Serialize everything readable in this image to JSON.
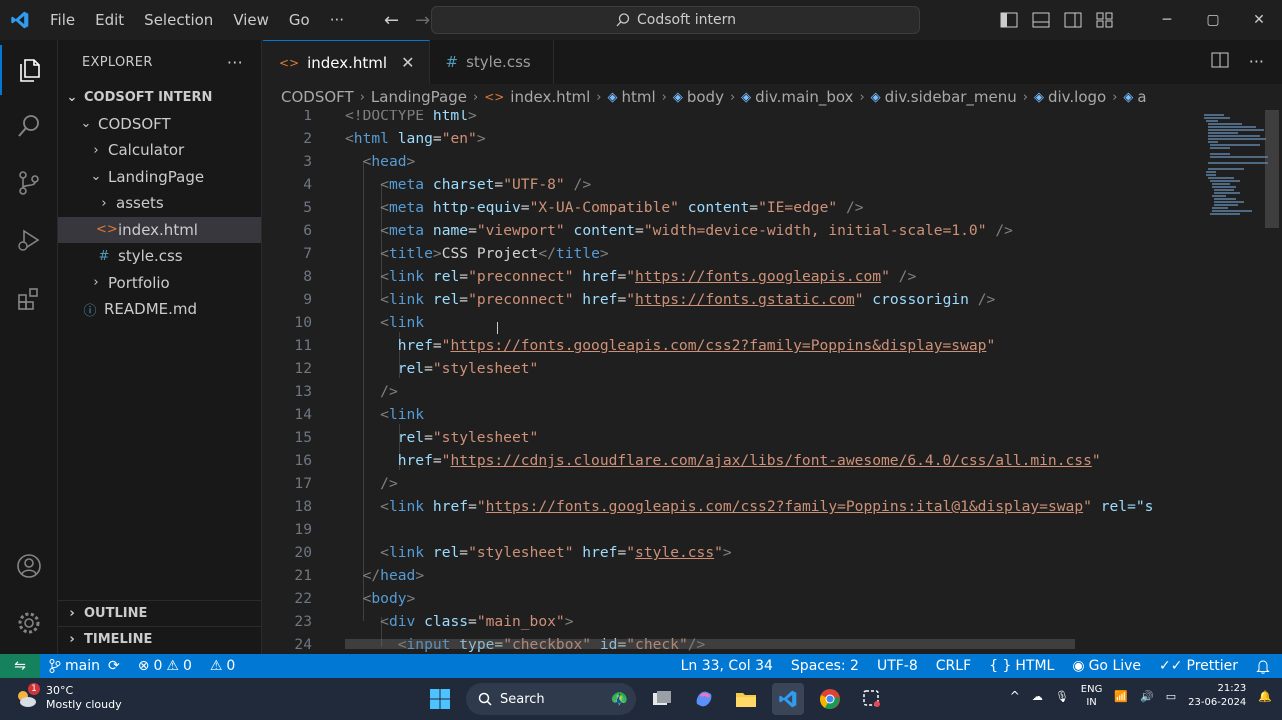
{
  "titlebar": {
    "menu": [
      "File",
      "Edit",
      "Selection",
      "View",
      "Go",
      "···"
    ],
    "command_center": "Codsoft intern",
    "window_controls": [
      "─",
      "▢",
      "✕"
    ]
  },
  "sidebar": {
    "header": "EXPLORER",
    "more": "···",
    "root": "CODSOFT INTERN",
    "items": [
      {
        "label": "CODSOFT",
        "depth": 1,
        "chevron": "⌄"
      },
      {
        "label": "Calculator",
        "depth": 2,
        "chevron": "›"
      },
      {
        "label": "LandingPage",
        "depth": 2,
        "chevron": "⌄"
      },
      {
        "label": "assets",
        "depth": 3,
        "chevron": "›"
      },
      {
        "label": "index.html",
        "depth": 3,
        "icon": "<>"
      },
      {
        "label": "style.css",
        "depth": 3,
        "icon": "#"
      },
      {
        "label": "Portfolio",
        "depth": 2,
        "chevron": "›"
      },
      {
        "label": "README.md",
        "depth": 2,
        "icon": "ⓘ"
      }
    ],
    "outline": "OUTLINE",
    "timeline": "TIMELINE"
  },
  "tabs": [
    {
      "label": "index.html",
      "active": true,
      "icon": "<>",
      "close": "✕"
    },
    {
      "label": "style.css",
      "active": false,
      "icon": "#"
    }
  ],
  "breadcrumb": [
    "CODSOFT",
    "LandingPage",
    "index.html",
    "html",
    "body",
    "div.main_box",
    "div.sidebar_menu",
    "div.logo",
    "a"
  ],
  "code_lines": [
    {
      "n": "1"
    },
    {
      "n": "2"
    },
    {
      "n": "3"
    },
    {
      "n": "4"
    },
    {
      "n": "5"
    },
    {
      "n": "6"
    },
    {
      "n": "7"
    },
    {
      "n": "8"
    },
    {
      "n": "9"
    },
    {
      "n": "10"
    },
    {
      "n": "11"
    },
    {
      "n": "12"
    },
    {
      "n": "13"
    },
    {
      "n": "14"
    },
    {
      "n": "15"
    },
    {
      "n": "16"
    },
    {
      "n": "17"
    },
    {
      "n": "18"
    },
    {
      "n": "19"
    },
    {
      "n": "20"
    },
    {
      "n": "21"
    },
    {
      "n": "22"
    },
    {
      "n": "23"
    },
    {
      "n": "24"
    }
  ],
  "code": {
    "l1_doctype": "<!DOCTYPE",
    "l1_html": " html",
    "l2_lang": "\"en\"",
    "l4_charset": "\"UTF-8\"",
    "l5_equiv": "\"X-UA-Compatible\"",
    "l5_content": "\"IE=edge\"",
    "l6_name": "\"viewport\"",
    "l6_content": "\"width=device-width, initial-scale=1.0\"",
    "l7_title": "CSS Project",
    "l8_rel": "\"preconnect\"",
    "l8_href": "https://fonts.googleapis.com",
    "l9_rel": "\"preconnect\"",
    "l9_href": "https://fonts.gstatic.com",
    "l9_cross": "crossorigin",
    "l11_href": "https://fonts.googleapis.com/css2?family=Poppins&display=swap",
    "l12_rel": "\"stylesheet\"",
    "l15_rel": "\"stylesheet\"",
    "l16_href": "https://cdnjs.cloudflare.com/ajax/libs/font-awesome/6.4.0/css/all.min.css",
    "l18_href": "https://fonts.googleapis.com/css2?family=Poppins:ital@1&display=swap",
    "l18_rel": "rel=\"s",
    "l20_rel": "\"stylesheet\"",
    "l20_href": "style.css",
    "l23_class": "\"main_box\"",
    "l24_type": "\"checkbox\"",
    "l24_id": "\"check\""
  },
  "statusbar": {
    "branch": "main",
    "errors": "0",
    "warnings": "0",
    "ports": "0",
    "position": "Ln 33, Col 34",
    "spaces": "Spaces: 2",
    "encoding": "UTF-8",
    "eol": "CRLF",
    "language": "HTML",
    "golive": "Go Live",
    "prettier": "Prettier"
  },
  "taskbar": {
    "weather_badge": "1",
    "temperature": "30°C",
    "weather": "Mostly cloudy",
    "search": "Search",
    "lang1": "ENG",
    "lang2": "IN",
    "time": "21:23",
    "date": "23-06-2024"
  },
  "colors": {
    "accent": "#0078d4",
    "remote": "#16825d",
    "tag": "#569cd6",
    "attr": "#9cdcfe",
    "string": "#ce9178"
  }
}
